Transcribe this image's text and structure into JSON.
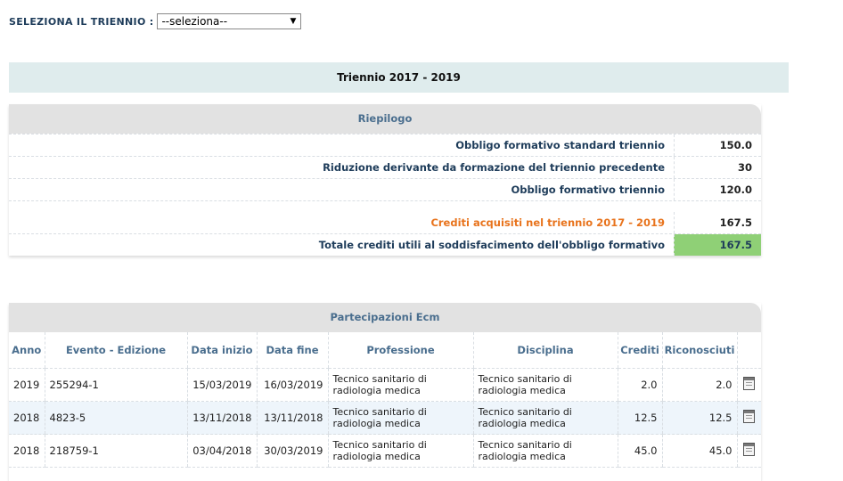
{
  "selector": {
    "label": "SELEZIONA IL TRIENNIO :",
    "value": "--seleziona--"
  },
  "triennio_title": "Triennio 2017 - 2019",
  "riepilogo": {
    "title": "Riepilogo",
    "rows": [
      {
        "label": "Obbligo formativo standard triennio",
        "value": "150.0"
      },
      {
        "label": "Riduzione derivante da formazione del triennio precedente",
        "value": "30"
      },
      {
        "label": "Obbligo formativo triennio",
        "value": "120.0"
      },
      {
        "label": "Crediti acquisiti nel triennio 2017 - 2019",
        "value": "167.5"
      },
      {
        "label": "Totale crediti utili al soddisfacimento dell'obbligo formativo",
        "value": "167.5"
      }
    ],
    "colors": {
      "highlight_label": "#e8731c",
      "total_bg": "#8fd076"
    }
  },
  "partecipazioni": {
    "title": "Partecipazioni Ecm",
    "columns": [
      "Anno",
      "Evento - Edizione",
      "Data inizio",
      "Data fine",
      "Professione",
      "Disciplina",
      "Crediti",
      "Riconosciuti",
      ""
    ],
    "rows": [
      {
        "anno": "2019",
        "evento": "255294-1",
        "inizio": "15/03/2019",
        "fine": "16/03/2019",
        "professione": "Tecnico sanitario di radiologia medica",
        "disciplina": "Tecnico sanitario di radiologia medica",
        "crediti": "2.0",
        "riconosciuti": "2.0",
        "icon": "document-icon"
      },
      {
        "anno": "2018",
        "evento": "4823-5",
        "inizio": "13/11/2018",
        "fine": "13/11/2018",
        "professione": "Tecnico sanitario di radiologia medica",
        "disciplina": "Tecnico sanitario di radiologia medica",
        "crediti": "12.5",
        "riconosciuti": "12.5",
        "icon": "document-icon"
      },
      {
        "anno": "2018",
        "evento": "218759-1",
        "inizio": "03/04/2018",
        "fine": "30/03/2019",
        "professione": "Tecnico sanitario di radiologia medica",
        "disciplina": "Tecnico sanitario di radiologia medica",
        "crediti": "45.0",
        "riconosciuti": "45.0",
        "icon": "document-icon"
      }
    ]
  }
}
